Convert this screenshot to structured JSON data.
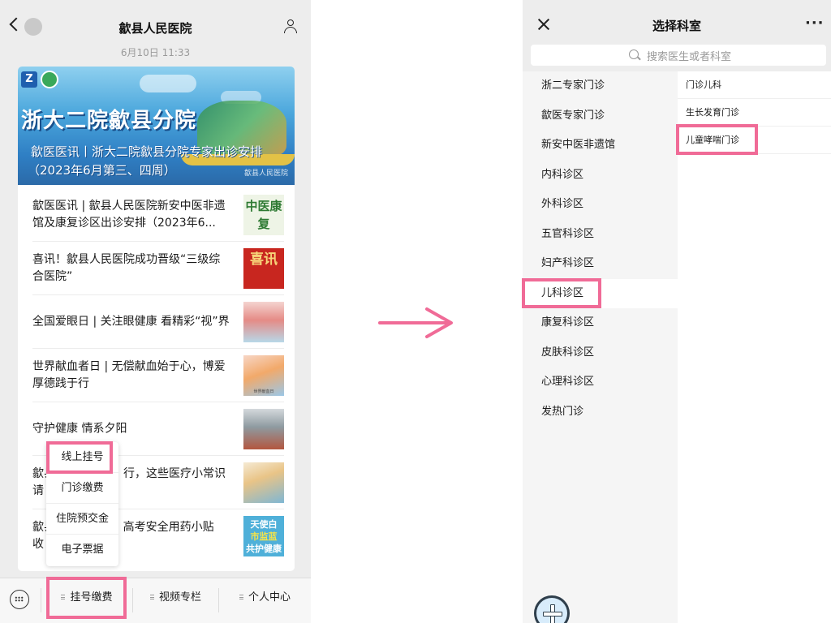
{
  "left_screen": {
    "chat_title": "歙县人民医院",
    "timestamp": "6月10日 11:33",
    "banner": {
      "headline": "浙大二院歙县分院",
      "subtitle_line1": "歙医医讯丨浙大二院歙县分院专家出诊安排",
      "subtitle_line2": "（2023年6月第三、四周）",
      "watermark": "歙县人民医院",
      "logo_letter": "Z"
    },
    "articles": [
      {
        "title": "歙医医讯 | 歙县人民医院新安中医非遗馆及康复诊区出诊安排（2023年6...",
        "thumb_text": "中医康复"
      },
      {
        "title": "喜讯！歙县人民医院成功晋级“三级综合医院”",
        "thumb_text": "喜讯"
      },
      {
        "title": "全国爱眼日 | 关注眼健康 看精彩“视”界"
      },
      {
        "title": "世界献血者日 | 无偿献血始于心，博爱厚德践于行",
        "thumb_caption": "世界献血日"
      },
      {
        "title": "守护健康  情系夕阳"
      },
      {
        "title": "歙县　　　　　　行，这些医疗小常识请　　　　　"
      },
      {
        "title": "歙县　　　　护 | 高考安全用药小贴　　　　　　收",
        "thumb_line1": "天使白",
        "thumb_line2": "市监蓝",
        "thumb_line3": "共护健康"
      }
    ],
    "popup_menu": [
      "线上挂号",
      "门诊缴费",
      "住院预交金",
      "电子票据"
    ],
    "bottom_tabs": [
      "挂号缴费",
      "视频专栏",
      "个人中心"
    ]
  },
  "right_screen": {
    "title": "选择科室",
    "more": "···",
    "search_placeholder": "搜索医生或者科室",
    "departments": [
      "浙二专家门诊",
      "歙医专家门诊",
      "新安中医非遗馆",
      "内科诊区",
      "外科诊区",
      "五官科诊区",
      "妇产科诊区",
      "儿科诊区",
      "康复科诊区",
      "皮肤科诊区",
      "心理科诊区",
      "发热门诊"
    ],
    "selected_department": "儿科诊区",
    "sub_departments": [
      "门诊儿科",
      "生长发育门诊",
      "儿童哮喘门诊"
    ]
  },
  "colors": {
    "highlight": "#f06b97",
    "arrow": "#f06b97",
    "banner_blue": "#2f7fc4",
    "selected_bg": "#ffffff",
    "list_bg": "#f5f5f5"
  },
  "icons": [
    "back-chevron-icon",
    "person-icon",
    "keyboard-icon",
    "close-icon",
    "more-icon",
    "search-icon",
    "plus-icon"
  ]
}
